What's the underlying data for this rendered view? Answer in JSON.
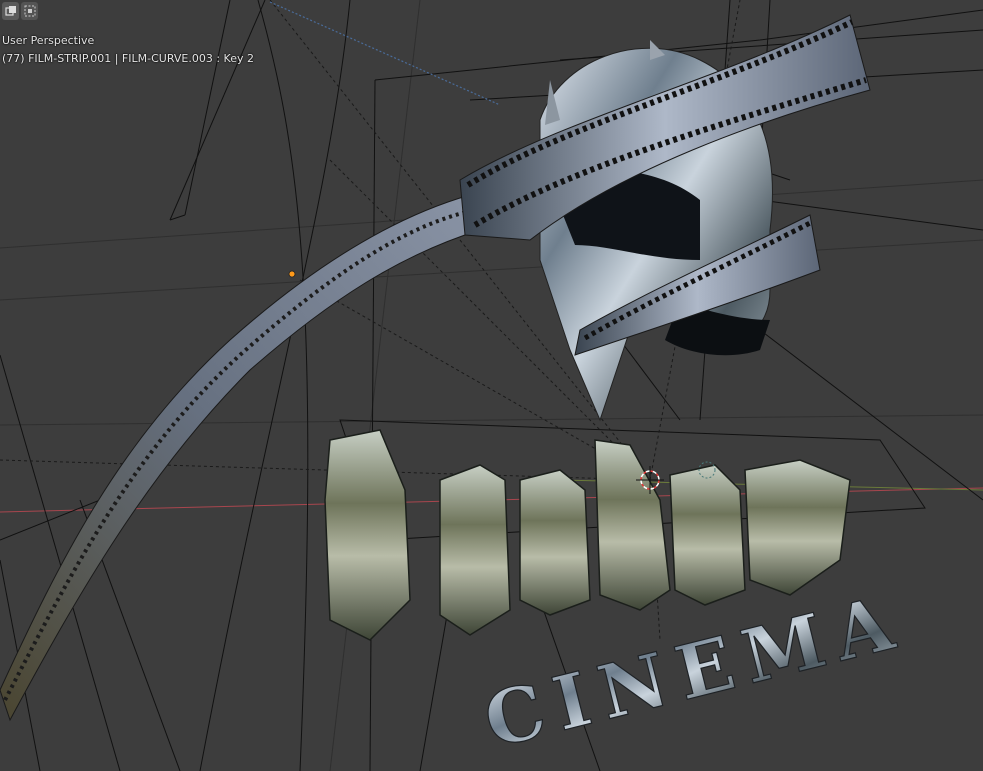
{
  "toolbar": {
    "buttons": [
      {
        "icon": "select-box-icon",
        "active": true
      },
      {
        "icon": "select-extend-icon",
        "active": false
      }
    ]
  },
  "overlay": {
    "view_name": "User Perspective",
    "object_info": "(77) FILM-STRIP.001 | FILM-CURVE.003 : Key 2"
  },
  "scene": {
    "logo_lettering": "barbar",
    "sub_lettering": "CINEMA"
  },
  "colors": {
    "background": "#3d3d3d",
    "wire": "#111111",
    "x_axis": "#a8464e",
    "y_axis": "#6a7a3a",
    "origin_point": "#ff9a1a",
    "cursor_red": "#e33a3a"
  }
}
